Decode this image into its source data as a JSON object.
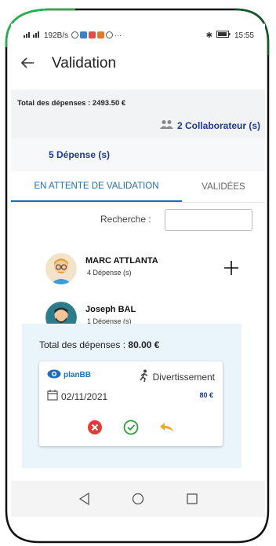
{
  "status_bar": {
    "left_text": "192B/s",
    "right_time": "15:55"
  },
  "app_bar": {
    "back_icon": "arrow-left-icon",
    "title": "Validation"
  },
  "summary": {
    "total_label": "Total des dépenses : 2493.50 €",
    "collaborators_label": "2 Collaborateur (s)",
    "expenses_count_label": "5 Dépense (s)"
  },
  "tabs": [
    {
      "label": "EN ATTENTE DE VALIDATION",
      "active": true
    },
    {
      "label": "VALIDÉES",
      "active": false
    }
  ],
  "search": {
    "label": "Recherche :",
    "value": "",
    "placeholder": ""
  },
  "collaborators": [
    {
      "name": "MARC ATTLANTA",
      "count": "4 Dépense (s)",
      "toggle": "+",
      "expanded": false
    },
    {
      "name": "Joseph BAL",
      "count": "1 Dépense (s)",
      "toggle": "—",
      "expanded": true
    }
  ],
  "detail": {
    "total_prefix": "Total des dépenses : ",
    "total_value": "80.00 €",
    "expense": {
      "brand": "planBB",
      "category": "Divertissement",
      "date": "02/11/2021",
      "amount": "80 €"
    }
  },
  "colors": {
    "accent": "#1f6fb5",
    "navy": "#1e3a8a",
    "frame_green": "#22b14c",
    "reject": "#e53935",
    "approve": "#2e9d3a",
    "undo": "#f5a623"
  }
}
